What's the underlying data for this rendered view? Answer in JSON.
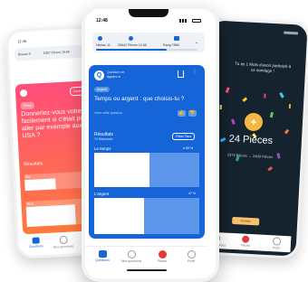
{
  "left_phone": {
    "time": "12:46",
    "stats": [
      "Niveau 9",
      "5357 Pièces 19,68"
    ],
    "tag": "Pièce",
    "action_label": "Connecté",
    "question": "Donneriez-vous votre vie facilement si c'était pour aller par exemple aux USA ?",
    "answer_label": "Résultats",
    "option_yes": "Oui",
    "option_no": "Non",
    "nav": [
      "Questions",
      "Mes questions"
    ]
  },
  "center_phone": {
    "time": "12:48",
    "stats": {
      "level": "Niveau 11",
      "coins": "35642 Pièces 12,85",
      "rank": "Rang 7866"
    },
    "author": "Question de",
    "author_name": "Appéro ●",
    "tag": "Argent",
    "question": "Temps ou argent : que choisis-tu ?",
    "report_label": "Voter cette question",
    "results_title": "Résultats",
    "results_count": "74 Réponses",
    "share_button": "Filtrer Tous",
    "options": [
      {
        "label": "Le temps",
        "percent_text": "● 53 %",
        "percent": 53
      },
      {
        "label": "L'argent",
        "percent_text": "47 %",
        "percent": 47
      }
    ],
    "nav": [
      "Questions",
      "Mes questions",
      "Pièces",
      "Profil"
    ]
  },
  "right_phone": {
    "header_text": "Tu as 1 Mois d'avoir participé à ce sondage !",
    "coins_title": "24 Pièces",
    "coins_detail": "2375 Pièces → 2400 Pièces",
    "button_label": "Fermer",
    "nav": [
      "Mes questions",
      "Pièces",
      "Profil"
    ]
  },
  "colors": {
    "blue": "#1565d8",
    "pink_top": "#ff4d7a",
    "pink_bottom": "#ff6f3c",
    "dark": "#14232e"
  }
}
